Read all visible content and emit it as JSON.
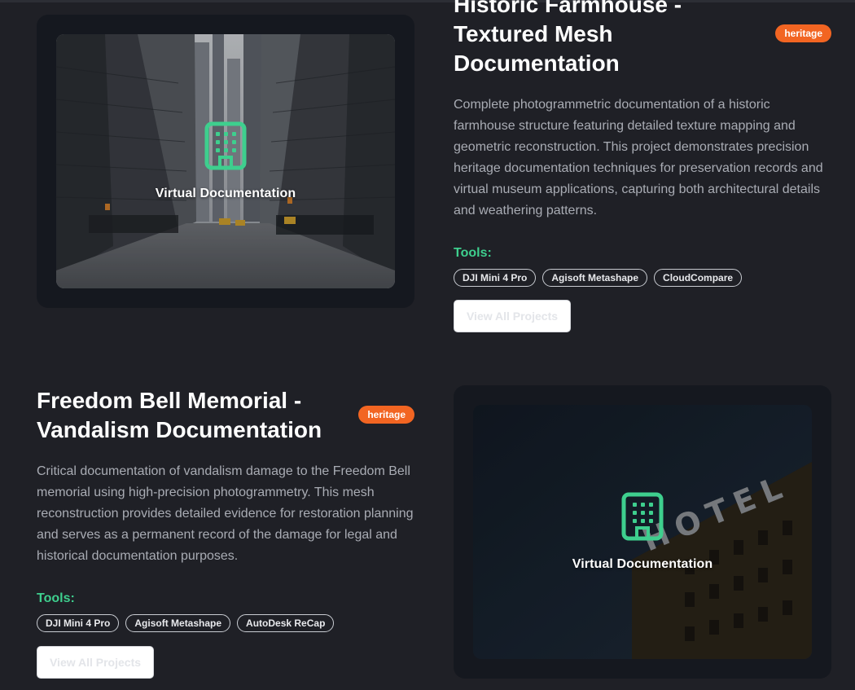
{
  "projects": [
    {
      "title": "Historic Farmhouse - Textured Mesh Documentation",
      "badge": "heritage",
      "description": "Complete photogrammetric documentation of a historic farmhouse structure featuring detailed texture mapping and geometric reconstruction. This project demonstrates precision heritage documentation techniques for preservation records and virtual museum applications, capturing both architectural details and weathering patterns.",
      "tools_label": "Tools:",
      "tools": [
        "DJI Mini 4 Pro",
        "Agisoft Metashape",
        "CloudCompare"
      ],
      "button_label": "View All Projects",
      "media_label": "Virtual Documentation",
      "media_icon": "building-icon"
    },
    {
      "title": "Freedom Bell Memorial - Vandalism Documentation",
      "badge": "heritage",
      "description": "Critical documentation of vandalism damage to the Freedom Bell memorial using high-precision photogrammetry. This mesh reconstruction provides detailed evidence for restoration planning and serves as a permanent record of the damage for legal and historical documentation purposes.",
      "tools_label": "Tools:",
      "tools": [
        "DJI Mini 4 Pro",
        "Agisoft Metashape",
        "AutoDesk ReCap"
      ],
      "button_label": "View All Projects",
      "media_label": "Virtual Documentation",
      "media_icon": "building-icon",
      "sign_text": "HOTEL"
    }
  ],
  "colors": {
    "background": "#1f2026",
    "accent_green": "#3ecf8e",
    "badge_orange": "#f26522"
  }
}
